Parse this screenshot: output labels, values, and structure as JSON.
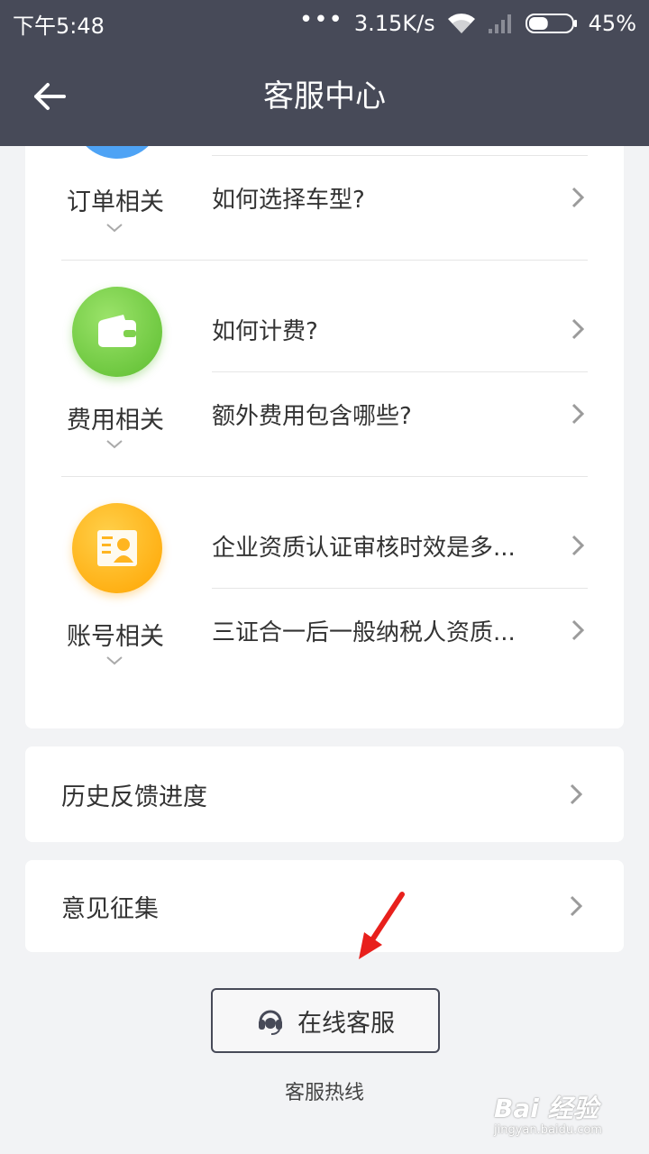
{
  "status_bar": {
    "time": "下午5:48",
    "dots": "•••",
    "speed": "3.15K/s",
    "battery": "45%",
    "battery_level": 0.45
  },
  "nav": {
    "title": "客服中心",
    "back_icon": "arrow-left-icon"
  },
  "faq": {
    "categories": [
      {
        "label": "订单相关",
        "icon": "order-icon",
        "color": "#4ea3f5",
        "questions": [
          "如何选择车型?"
        ]
      },
      {
        "label": "费用相关",
        "icon": "wallet-icon",
        "color": "#5cbd2f",
        "questions": [
          "如何计费?",
          "额外费用包含哪些?"
        ]
      },
      {
        "label": "账号相关",
        "icon": "id-card-icon",
        "color": "#ffa400",
        "questions": [
          "企业资质认证审核时效是多...",
          "三证合一后一般纳税人资质..."
        ]
      }
    ]
  },
  "links": {
    "history_feedback": "历史反馈进度",
    "suggestions": "意见征集"
  },
  "online_service": {
    "label": "在线客服",
    "icon": "headset-icon"
  },
  "hotline": "客服热线",
  "watermark": {
    "brand": "Bai 经验",
    "url": "jingyan.baidu.com"
  },
  "colors": {
    "header": "#474a58",
    "background": "#f2f3f5",
    "annotation_arrow": "#e8201c"
  }
}
